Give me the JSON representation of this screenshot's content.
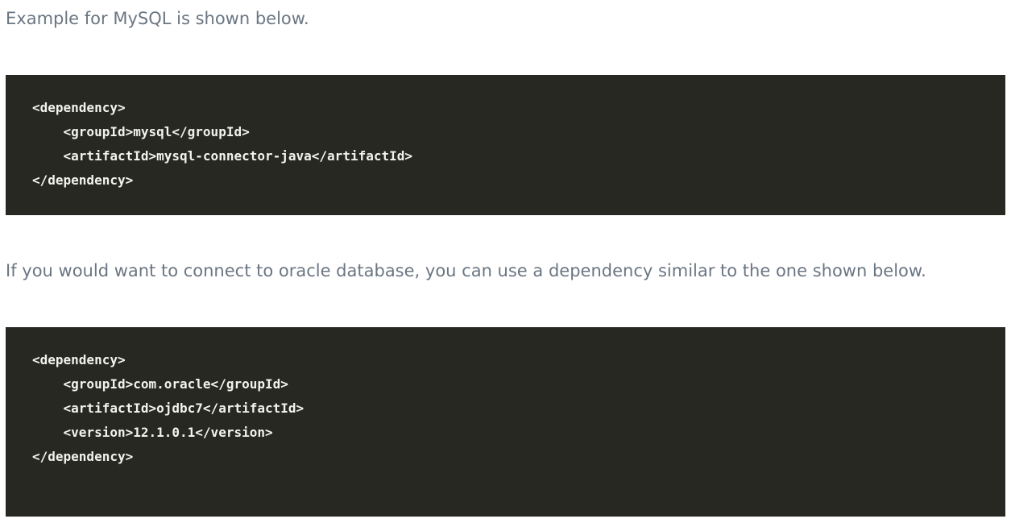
{
  "paragraphs": {
    "mysql_intro": "Example for MySQL is shown below.",
    "oracle_intro": "If you would want to connect to oracle database, you can use a dependency similar to the one shown below."
  },
  "code_blocks": {
    "mysql": {
      "lines": [
        "<dependency>",
        "    <groupId>mysql</groupId>",
        "    <artifactId>mysql-connector-java</artifactId>",
        "</dependency>"
      ]
    },
    "oracle": {
      "lines": [
        "<dependency>",
        "    <groupId>com.oracle</groupId>",
        "    <artifactId>ojdbc7</artifactId>",
        "    <version>12.1.0.1</version>",
        "</dependency>"
      ]
    }
  },
  "colors": {
    "paragraph_text": "#6b7683",
    "code_background": "#282822",
    "code_text": "#f3f3ee"
  }
}
